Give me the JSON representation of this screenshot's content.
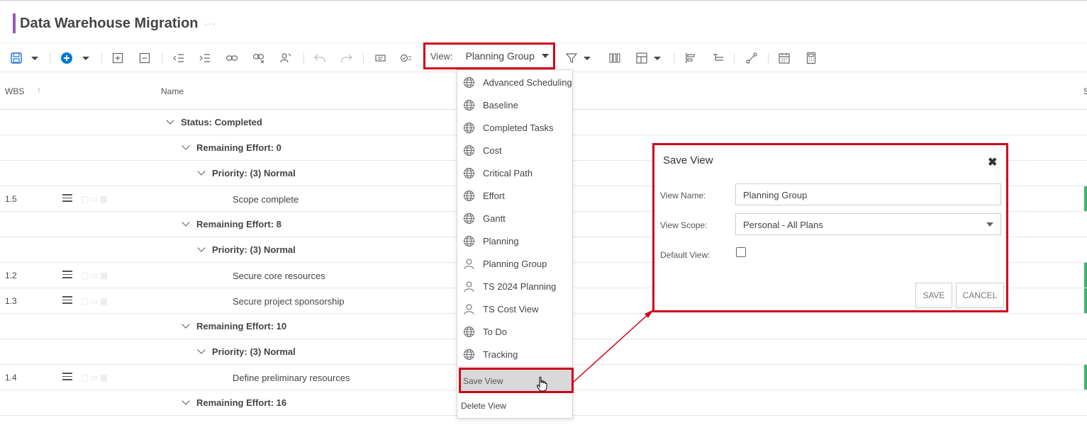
{
  "title": "Data Warehouse Migration",
  "title_more": "···",
  "toolbar": {
    "view_label": "View:",
    "view_value": "Planning Group",
    "icons": [
      "save-icon",
      "dropdown-icon",
      "add-icon",
      "dropdown-icon",
      "expand-all-icon",
      "collapse-all-icon",
      "outdent-icon",
      "indent-icon",
      "link-icon",
      "unlink-icon",
      "assign-icon",
      "undo-icon",
      "redo-icon",
      "notes-icon",
      "checklist-icon",
      "filter-icon",
      "columns-icon",
      "group-icon",
      "align-icon",
      "outline-icon",
      "connect-icon",
      "calendar-icon",
      "calculator-icon"
    ]
  },
  "grid": {
    "headers": {
      "wbs": "WBS",
      "sort_arrow": "↑",
      "name": "Name",
      "edge": "S"
    },
    "rows": [
      {
        "type": "group",
        "level": 0,
        "label": "Status: Completed"
      },
      {
        "type": "group",
        "level": 1,
        "label": "Remaining Effort: 0"
      },
      {
        "type": "group",
        "level": 2,
        "label": "Priority: (3) Normal"
      },
      {
        "type": "task",
        "wbs": "1.5",
        "name": "Scope complete"
      },
      {
        "type": "group",
        "level": 1,
        "label": "Remaining Effort: 8"
      },
      {
        "type": "group",
        "level": 2,
        "label": "Priority: (3) Normal"
      },
      {
        "type": "task",
        "wbs": "1.2",
        "name": "Secure core resources"
      },
      {
        "type": "task",
        "wbs": "1.3",
        "name": "Secure project sponsorship"
      },
      {
        "type": "group",
        "level": 1,
        "label": "Remaining Effort: 10"
      },
      {
        "type": "group",
        "level": 2,
        "label": "Priority: (3) Normal"
      },
      {
        "type": "task",
        "wbs": "1.4",
        "name": "Define preliminary resources"
      },
      {
        "type": "group",
        "level": 1,
        "label": "Remaining Effort: 16"
      }
    ]
  },
  "view_menu": {
    "items": [
      {
        "label": "Advanced Scheduling",
        "icon": "globe-icon"
      },
      {
        "label": "Baseline",
        "icon": "globe-icon"
      },
      {
        "label": "Completed Tasks",
        "icon": "globe-icon"
      },
      {
        "label": "Cost",
        "icon": "globe-icon"
      },
      {
        "label": "Critical Path",
        "icon": "globe-icon"
      },
      {
        "label": "Effort",
        "icon": "globe-icon"
      },
      {
        "label": "Gantt",
        "icon": "globe-icon"
      },
      {
        "label": "Planning",
        "icon": "globe-icon"
      },
      {
        "label": "Planning Group",
        "icon": "person-icon"
      },
      {
        "label": "TS 2024 Planning",
        "icon": "person-icon"
      },
      {
        "label": "TS Cost View",
        "icon": "person-icon"
      },
      {
        "label": "To Do",
        "icon": "globe-icon"
      },
      {
        "label": "Tracking",
        "icon": "globe-icon"
      }
    ],
    "save_view": "Save View",
    "delete_view": "Delete View"
  },
  "dialog": {
    "title": "Save View",
    "close": "✖",
    "view_name_label": "View Name:",
    "view_name_value": "Planning Group",
    "view_scope_label": "View Scope:",
    "view_scope_value": "Personal - All Plans",
    "default_view_label": "Default View:",
    "default_view_checked": false,
    "save_label": "SAVE",
    "cancel_label": "CANCEL"
  },
  "colors": {
    "accent": "#9b59b6",
    "highlight_border": "#d0021b",
    "primary_blue": "#0078d4",
    "status_green": "#3cb371"
  }
}
